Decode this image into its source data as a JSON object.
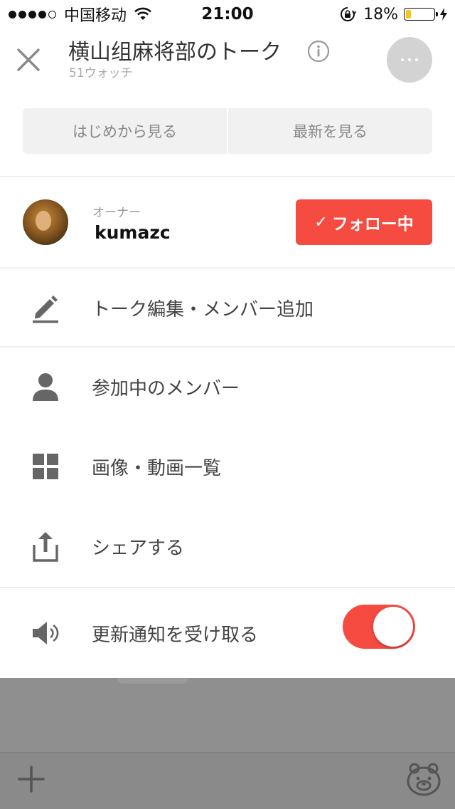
{
  "status_bar": {
    "carrier": "中国移动",
    "time": "21:00",
    "battery": "18%",
    "battery_level": 0.18,
    "signal_bars": 4,
    "signal_total": 5
  },
  "header": {
    "title": "横山组麻将部のトーク",
    "subtitle": "51ウォッチ",
    "close_icon": "close-icon",
    "info_icon": "info-icon",
    "more_icon": "more-icon"
  },
  "segment": {
    "from_start": "はじめから見る",
    "latest": "最新を見る"
  },
  "owner": {
    "label": "オーナー",
    "name": "kumazc",
    "follow_check": "✓",
    "follow_label": "フォロー中"
  },
  "menu": {
    "edit": "トーク編集・メンバー追加",
    "members": "参加中のメンバー",
    "media": "画像・動画一覧",
    "share": "シェアする",
    "notify": "更新通知を受け取る",
    "notify_enabled": true
  },
  "colors": {
    "accent": "#f54b41",
    "battery": "#f5c518",
    "overlay": "#8f8f8f"
  }
}
